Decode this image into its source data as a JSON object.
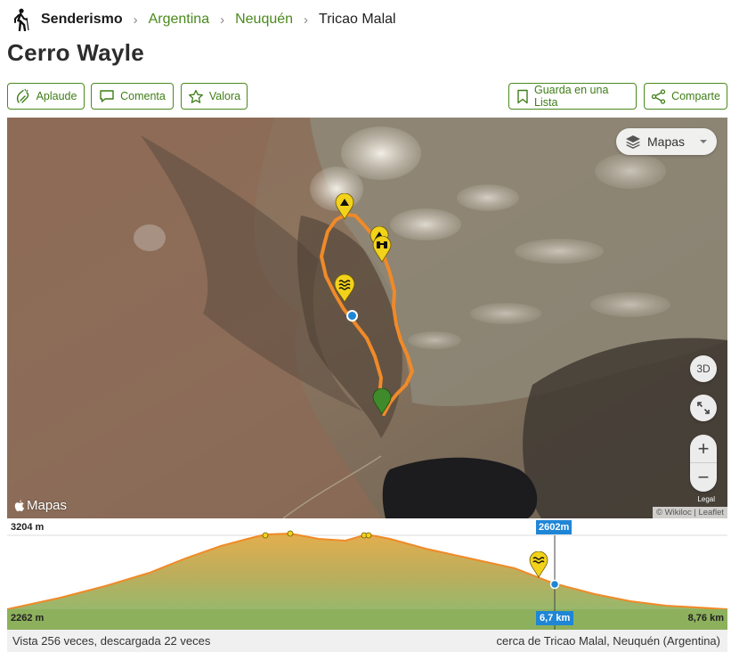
{
  "breadcrumb": {
    "root": "Senderismo",
    "items": [
      "Argentina",
      "Neuquén",
      "Tricao Malal"
    ]
  },
  "title": "Cerro Wayle",
  "actions": {
    "applaud": "Aplaude",
    "comment": "Comenta",
    "rate": "Valora",
    "save_list": "Guarda en una Lista",
    "share": "Comparte"
  },
  "map": {
    "layer_select": "Mapas",
    "btn_3d": "3D",
    "zoom_in": "+",
    "zoom_out": "−",
    "legal": "Legal",
    "attribution": "© Wikiloc | Leaflet",
    "provider_logo": "Mapas"
  },
  "profile": {
    "max_elevation": "3204 m",
    "min_elevation": "2262 m",
    "total_distance": "8,76 km",
    "cursor_elevation": "2602m",
    "cursor_distance": "6,7 km"
  },
  "footer": {
    "stats": "Vista 256 veces, descargada 22 veces",
    "location": "cerca de Tricao Malal, Neuquén (Argentina)"
  },
  "colors": {
    "accent_green": "#4a8a1c",
    "track_orange": "#f08a28",
    "cursor_blue": "#1f86d6",
    "waypoint_yellow": "#f2d21a",
    "start_marker_green": "#3f8a2a"
  }
}
